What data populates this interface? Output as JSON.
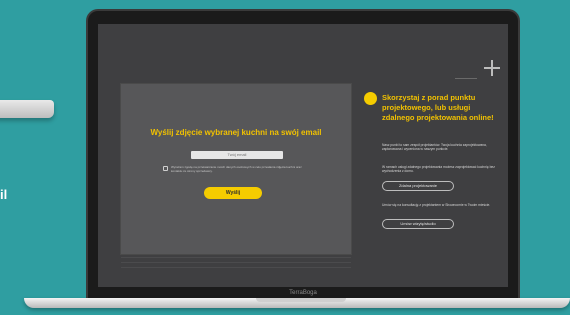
{
  "background_color": "#2f9ea1",
  "accent_color": "#f5cc00",
  "left_edge_text": "il",
  "laptop": {
    "brand": "TerraBoga"
  },
  "form": {
    "title": "Wyślij zdjęcie wybranej kuchni na swój email",
    "email_placeholder": "Twój email",
    "consent_text": "Wyrażam zgodę na przetwarzanie moich danych osobowych w celu przesłania zdjęcia kuchni oraz kontaktu ze strony sprzedawcy.",
    "send_label": "Wyślij"
  },
  "promo": {
    "title": "Skorzystaj z porad punktu projektowego, lub usługi zdalnego projektowania online!",
    "paragraph1": "Nasz punkt to sam zespół projektantów. Twoja kuchnia zaprojektowana, zaplanowana i wyceniona w naszym punkcie.",
    "paragraph2": "W ramach usługi zdalnego projektowania możesz zaprojektować kuchnię bez wychodzenia z domu.",
    "studio_button": "Zdalna projektowanie",
    "paragraph3": "Umów się na konsultację z projektantem w Showroomie w Twoim mieście.",
    "showroom_button": "Umów wizytę/studio"
  }
}
